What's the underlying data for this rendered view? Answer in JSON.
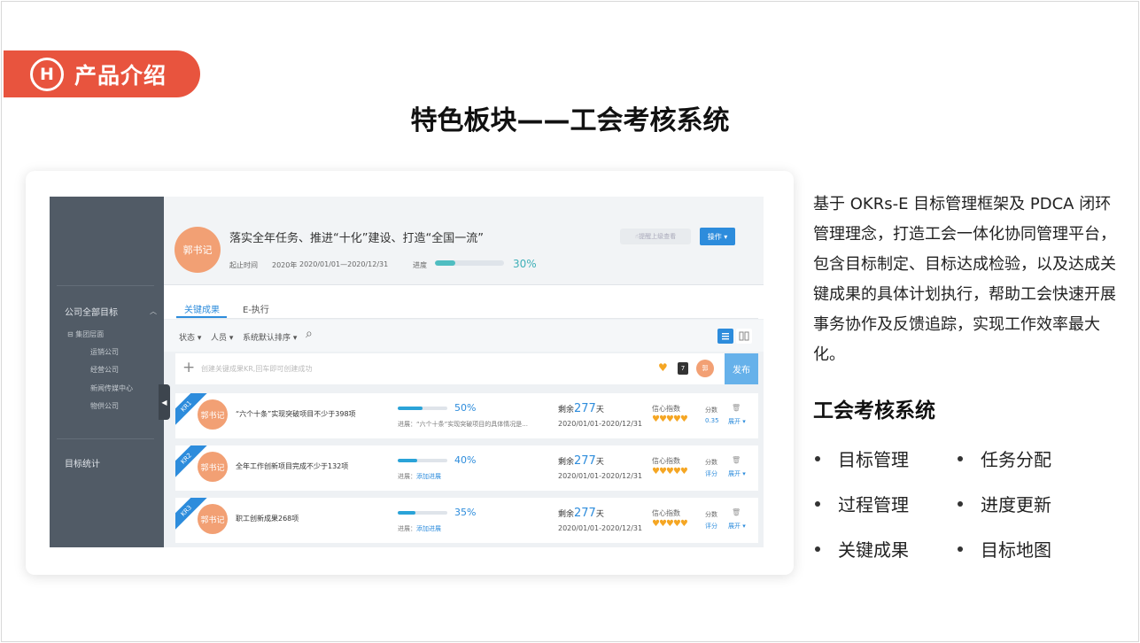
{
  "badge": {
    "logo": "H",
    "text": "产品介绍"
  },
  "title": "特色板块——工会考核系统",
  "app": {
    "sidebar": {
      "section1": "公司全部目标",
      "group": "集团层面",
      "subs": [
        "运销公司",
        "经营公司",
        "新闻传媒中心",
        "物供公司"
      ],
      "section2": "目标统计",
      "toggle_glyph": "◀",
      "chevron": "︿"
    },
    "header": {
      "avatar": "郭书记",
      "title": "落实全年任务、推进“十化”建设、打造“全国一流”",
      "period_label": "起止时间",
      "year": "2020年",
      "range": "2020/01/01—2020/12/31",
      "progress_label": "进度",
      "progress_pct": "30%",
      "progress_value": 0.3,
      "remind": "提醒上级查看",
      "op_button": "操作 ▾"
    },
    "tabs": [
      "关键成果",
      "E-执行"
    ],
    "filters": [
      "状态 ▾",
      "人员 ▾",
      "系统默认排序 ▾"
    ],
    "search_icon": "⌕",
    "create_placeholder": "创建关键成果KR,回车即可创建成功",
    "publish": "发布",
    "mini_avatar": "郭",
    "krs": [
      {
        "tag": "KR1",
        "avatar": "郭书记",
        "title": "“六个十条”实现突破项目不少于398项",
        "pct": "50%",
        "progress": 0.5,
        "note": "进展：“六个十条”实现突破项目的具体情况是...",
        "note_link": "",
        "remain_pre": "剩余",
        "remain_days": "277",
        "remain_post": "天",
        "range": "2020/01/01-2020/12/31",
        "conf": "信心指数",
        "hearts": "♥♥♥♥♥",
        "score_label": "分数",
        "score_value": "0.35",
        "expand": "展开 ▾"
      },
      {
        "tag": "KR2",
        "avatar": "郭书记",
        "title": "全年工作创新项目完成不少于132项",
        "pct": "40%",
        "progress": 0.4,
        "note": "进展：",
        "note_link": "添加进展",
        "remain_pre": "剩余",
        "remain_days": "277",
        "remain_post": "天",
        "range": "2020/01/01-2020/12/31",
        "conf": "信心指数",
        "hearts": "♥♥♥♥♥",
        "score_label": "分数",
        "score_value": "评分",
        "expand": "展开 ▾"
      },
      {
        "tag": "KR3",
        "avatar": "郭书记",
        "title": "职工创新成果268项",
        "pct": "35%",
        "progress": 0.35,
        "note": "进展：",
        "note_link": "添加进展",
        "remain_pre": "剩余",
        "remain_days": "277",
        "remain_post": "天",
        "range": "2020/01/01-2020/12/31",
        "conf": "信心指数",
        "hearts": "♥♥♥♥♥",
        "score_label": "分数",
        "score_value": "评分",
        "expand": "展开 ▾"
      }
    ]
  },
  "description": "基于 OKRs-E 目标管理框架及 PDCA 闭环管理理念，打造工会一体化协同管理平台，包含目标制定、目标达成检验，以及达成关键成果的具体计划执行，帮助工会快速开展事务协作及反馈追踪，实现工作效率最大化。",
  "features_title": "工会考核系统",
  "features": [
    "目标管理",
    "任务分配",
    "过程管理",
    "进度更新",
    "关键成果",
    "目标地图"
  ],
  "colors": {
    "accent_red": "#e8543e",
    "accent_blue": "#2d8cdc",
    "sidebar": "#515b66",
    "heart": "#f5a623"
  }
}
